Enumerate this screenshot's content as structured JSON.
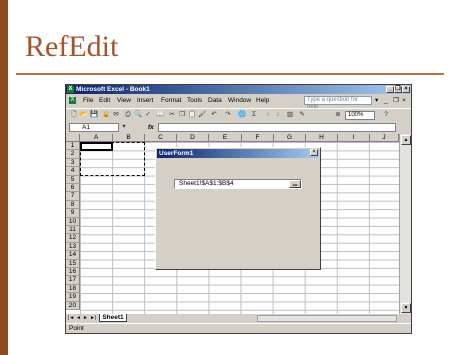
{
  "slide": {
    "title": "RefEdit"
  },
  "window": {
    "title": "Microsoft Excel - Book1",
    "controls": {
      "minimize": "_",
      "restore": "❐",
      "close": "×"
    }
  },
  "menu": {
    "items": [
      "File",
      "Edit",
      "View",
      "Insert",
      "Format",
      "Tools",
      "Data",
      "Window",
      "Help"
    ],
    "ask_placeholder": "Type a question for help",
    "ask_dropdown": "▾",
    "doc_minimize": "_",
    "doc_restore": "❐",
    "doc_close": "×"
  },
  "toolbar": {
    "icons": [
      "new-icon",
      "open-icon",
      "save-icon",
      "permission-icon",
      "email-icon",
      "print-icon",
      "print-preview-icon",
      "spelling-icon",
      "research-icon",
      "cut-icon",
      "copy-icon",
      "paste-icon",
      "format-painter-icon",
      "undo-icon",
      "redo-icon",
      "hyperlink-icon",
      "autosum-icon",
      "sort-ascending-icon",
      "sort-descending-icon",
      "chart-wizard-icon",
      "drawing-icon"
    ],
    "zoom": "100%",
    "help": "?"
  },
  "formula_bar": {
    "name_box": "A1",
    "fx": "fx"
  },
  "grid": {
    "columns": [
      "A",
      "B",
      "C",
      "D",
      "E",
      "F",
      "G",
      "H",
      "I",
      "J"
    ],
    "rows": [
      "1",
      "2",
      "3",
      "4",
      "5",
      "6",
      "7",
      "8",
      "9",
      "10",
      "11",
      "12",
      "13",
      "14",
      "15",
      "16",
      "17",
      "18",
      "19",
      "20"
    ]
  },
  "sheet_tabs": {
    "nav": [
      "|◄",
      "◄",
      "►",
      "►|"
    ],
    "active": "Sheet1"
  },
  "status": "Point",
  "dialog": {
    "title": "UserForm1",
    "close": "×",
    "refedit_value": "Sheet1!$A$1:$B$4",
    "refedit_button": "▁"
  }
}
